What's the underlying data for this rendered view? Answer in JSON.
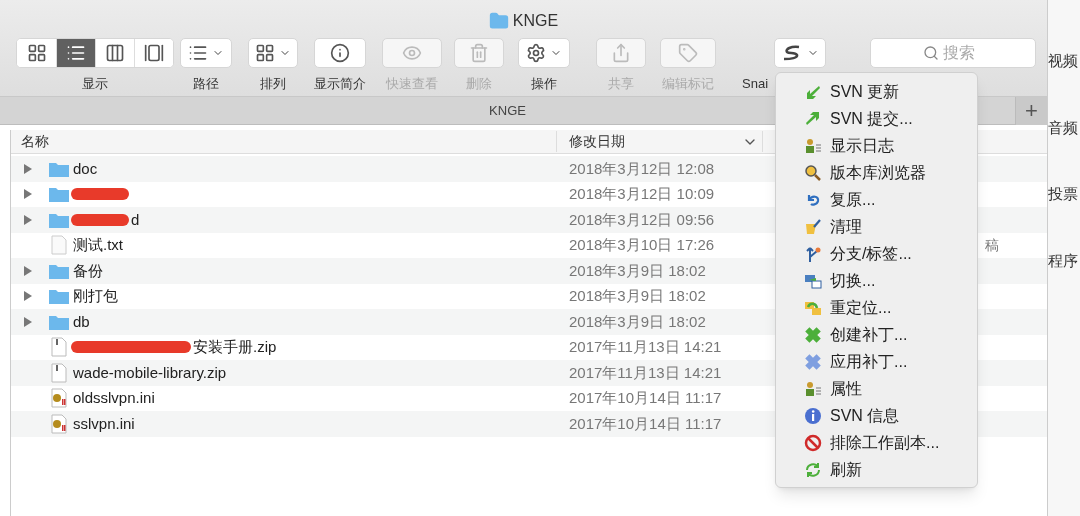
{
  "window": {
    "title": "KNGE"
  },
  "toolbar": {
    "view_label": "显示",
    "views": [
      {
        "kind": "icons",
        "selected": false
      },
      {
        "kind": "list",
        "selected": true
      },
      {
        "kind": "columns",
        "selected": false
      },
      {
        "kind": "gallery",
        "selected": false
      }
    ],
    "items": [
      {
        "kind": "path",
        "label": "路径",
        "disabled": false
      },
      {
        "kind": "arrange",
        "label": "排列",
        "disabled": false
      },
      {
        "kind": "info",
        "label": "显示简介",
        "disabled": false
      },
      {
        "kind": "quicklook",
        "label": "快速查看",
        "disabled": true
      },
      {
        "kind": "delete",
        "label": "删除",
        "disabled": true
      },
      {
        "kind": "action",
        "label": "操作",
        "disabled": false
      },
      {
        "kind": "share",
        "label": "共享",
        "disabled": true
      },
      {
        "kind": "tag",
        "label": "编辑标记",
        "disabled": true
      },
      {
        "kind": "snail",
        "label": "Snai",
        "disabled": false
      }
    ],
    "search": {
      "placeholder": "搜索"
    }
  },
  "tab_bar": {
    "title": "KNGE",
    "add": "+"
  },
  "table": {
    "columns": [
      "名称",
      "修改日期"
    ],
    "rows": [
      {
        "kind": "folder",
        "name": "doc",
        "redacted": false,
        "date": "2018年3月12日 12:08"
      },
      {
        "kind": "folder",
        "redacted": true,
        "date": "2018年3月12日 10:09"
      },
      {
        "kind": "folder",
        "name": "d",
        "redacted": true,
        "date": "2018年3月12日 09:56"
      },
      {
        "kind": "text",
        "name": "测试.txt",
        "redacted": false,
        "date": "2018年3月10日 17:26",
        "column_3": "稿"
      },
      {
        "kind": "folder",
        "name": "备份",
        "redacted": false,
        "date": "2018年3月9日 18:02"
      },
      {
        "kind": "folder",
        "name": "刚打包",
        "redacted": false,
        "date": "2018年3月9日 18:02"
      },
      {
        "kind": "folder",
        "name": "db",
        "redacted": false,
        "date": "2018年3月9日 18:02"
      },
      {
        "kind": "zip",
        "name": "安装手册.zip",
        "redacted": true,
        "date": "2017年11月13日 14:21"
      },
      {
        "kind": "zip",
        "name": "wade-mobile-library.zip",
        "redacted": false,
        "date": "2017年11月13日 14:21"
      },
      {
        "kind": "ini",
        "name": "oldsslvpn.ini",
        "redacted": false,
        "date": "2017年10月14日 11:17"
      },
      {
        "kind": "ini",
        "name": "sslvpn.ini",
        "redacted": false,
        "date": "2017年10月14日 11:17"
      }
    ]
  },
  "menu": [
    {
      "kind": "update",
      "label": "SVN 更新"
    },
    {
      "kind": "commit",
      "label": "SVN 提交..."
    },
    {
      "kind": "log",
      "label": "显示日志"
    },
    {
      "kind": "browser",
      "label": "版本库浏览器"
    },
    {
      "kind": "revert",
      "label": "复原..."
    },
    {
      "kind": "cleanup",
      "label": "清理"
    },
    {
      "kind": "branch",
      "label": "分支/标签..."
    },
    {
      "kind": "switch",
      "label": "切换..."
    },
    {
      "kind": "relocate",
      "label": "重定位..."
    },
    {
      "kind": "create_patch",
      "label": "创建补丁..."
    },
    {
      "kind": "apply_patch",
      "label": "应用补丁..."
    },
    {
      "kind": "properties",
      "label": "属性"
    },
    {
      "kind": "info",
      "label": "SVN 信息"
    },
    {
      "kind": "exclude",
      "label": "排除工作副本..."
    },
    {
      "kind": "refresh",
      "label": "刷新"
    }
  ],
  "background_window": {
    "items": [
      "视频",
      "音频",
      "投票",
      "程序"
    ]
  }
}
